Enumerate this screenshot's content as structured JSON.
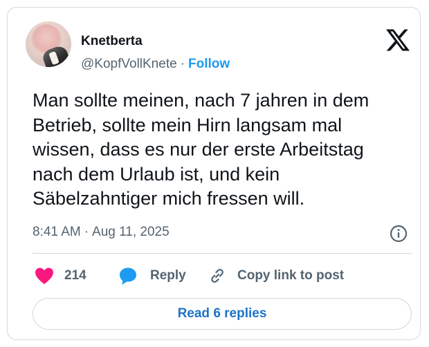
{
  "author": {
    "name": "Knetberta",
    "handle": "@KopfVollKnete",
    "separator": "·",
    "follow_label": "Follow"
  },
  "tweet": {
    "text": "Man sollte meinen, nach 7 jahren in dem Betrieb, sollte mein Hirn langsam mal wissen, dass es nur der erste Arbeitstag nach dem Urlaub ist, und kein Säbelzahntiger mich fressen will.",
    "time": "8:41 AM",
    "separator": "·",
    "date": "Aug 11, 2025"
  },
  "actions": {
    "likes": "214",
    "reply_label": "Reply",
    "copy_label": "Copy link to post"
  },
  "read_replies_label": "Read 6 replies",
  "icons": {
    "brand": "x-logo-icon",
    "info": "info-icon",
    "like": "heart-icon",
    "reply": "speech-bubble-icon",
    "copy": "link-icon"
  },
  "colors": {
    "accent": "#1d9bf0",
    "heart": "#f91880",
    "text": "#0f1419",
    "muted": "#536471",
    "border": "#cfd9de"
  }
}
